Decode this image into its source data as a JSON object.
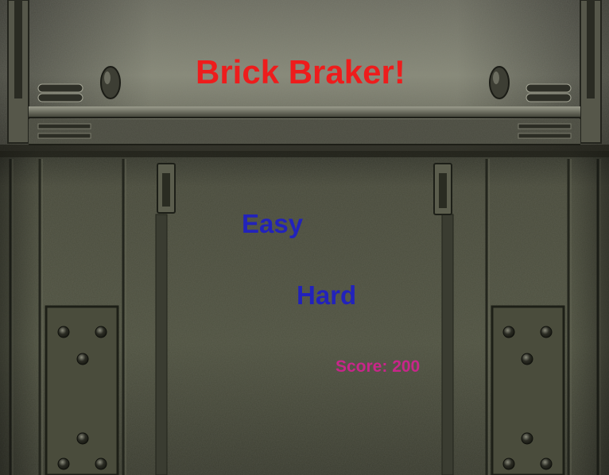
{
  "title": "Brick Braker!",
  "menu": {
    "easy_label": "Easy",
    "hard_label": "Hard"
  },
  "score_text": "Score: 200",
  "colors": {
    "title": "#ee1c1c",
    "menu_option": "#2222bb",
    "score": "#c8268a",
    "background_metal": "#4c4e3e"
  }
}
